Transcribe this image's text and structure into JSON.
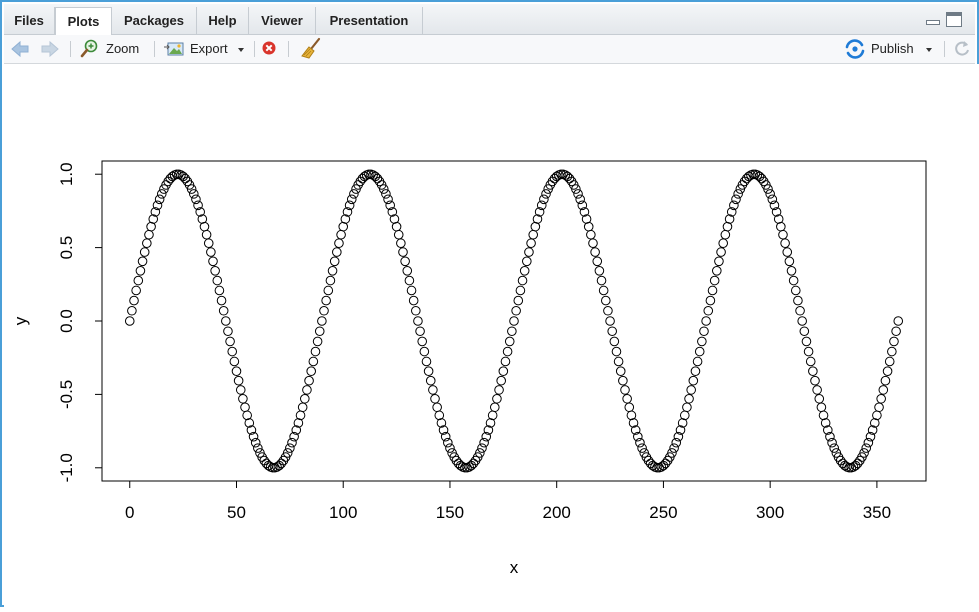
{
  "tabs": [
    {
      "label": "Files",
      "active": false
    },
    {
      "label": "Plots",
      "active": true
    },
    {
      "label": "Packages",
      "active": false
    },
    {
      "label": "Help",
      "active": false
    },
    {
      "label": "Viewer",
      "active": false
    },
    {
      "label": "Presentation",
      "active": false
    }
  ],
  "toolbar": {
    "back_icon": "arrow-left-icon",
    "forward_icon": "arrow-right-icon",
    "zoom_label": "Zoom",
    "export_label": "Export",
    "remove_icon": "remove-plot-icon",
    "clear_icon": "broom-icon",
    "publish_label": "Publish",
    "refresh_icon": "refresh-icon"
  },
  "colors": {
    "pane_border": "#4a9fd8",
    "publish_icon": "#1f7bd6",
    "remove_icon": "#d9342b"
  },
  "chart_data": {
    "type": "scatter",
    "marker": "open-circle",
    "function": "y = sin(4*pi*x/180)",
    "x_start": 0,
    "x_end": 360,
    "x_step": 1,
    "xlabel": "x",
    "ylabel": "y",
    "xlim": [
      -13,
      373
    ],
    "ylim": [
      -1.09,
      1.09
    ],
    "xticks": [
      0,
      50,
      100,
      150,
      200,
      250,
      300,
      350
    ],
    "yticks": [
      -1.0,
      -0.5,
      0.0,
      0.5,
      1.0
    ],
    "xtick_labels": [
      "0",
      "50",
      "100",
      "150",
      "200",
      "250",
      "300",
      "350"
    ],
    "ytick_labels": [
      "-1.0",
      "-0.5",
      "0.0",
      "0.5",
      "1.0"
    ],
    "grid": false
  }
}
